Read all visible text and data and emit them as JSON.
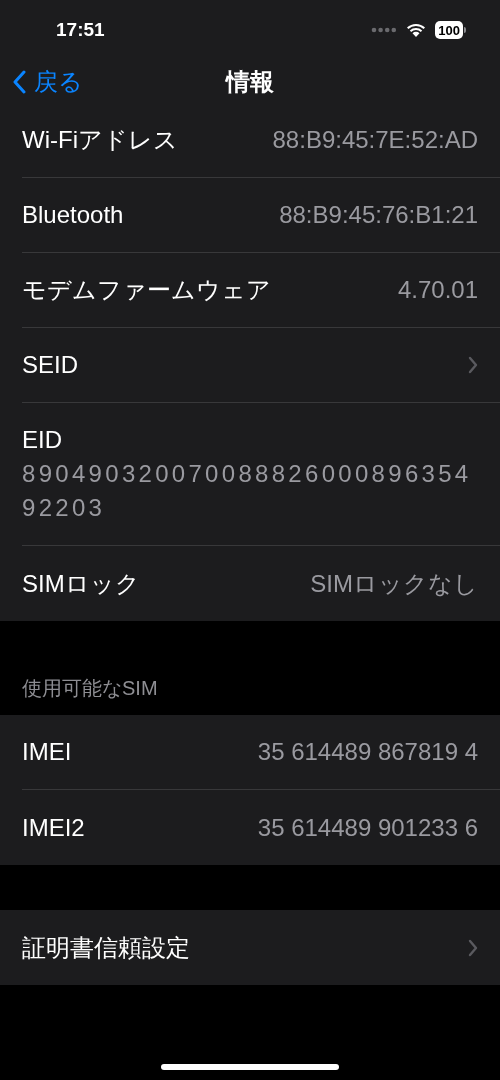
{
  "status_bar": {
    "time": "17:51",
    "battery": "100"
  },
  "nav": {
    "back": "戻る",
    "title": "情報"
  },
  "groups": [
    {
      "rows": [
        {
          "kind": "value",
          "label": "Wi-Fiアドレス",
          "value": "88:B9:45:7E:52:AD"
        },
        {
          "kind": "value",
          "label": "Bluetooth",
          "value": "88:B9:45:76:B1:21"
        },
        {
          "kind": "value",
          "label": "モデムファームウェア",
          "value": "4.70.01"
        },
        {
          "kind": "chevron",
          "label": "SEID"
        },
        {
          "kind": "stacked",
          "label": "EID",
          "value": "89049032007008882600089635492203"
        },
        {
          "kind": "value",
          "label": "SIMロック",
          "value": "SIMロックなし"
        }
      ]
    },
    {
      "header": "使用可能なSIM",
      "rows": [
        {
          "kind": "value",
          "label": "IMEI",
          "value": "35 614489 867819 4"
        },
        {
          "kind": "value",
          "label": "IMEI2",
          "value": "35 614489 901233 6"
        }
      ]
    },
    {
      "rows": [
        {
          "kind": "chevron",
          "label": "証明書信頼設定"
        }
      ]
    }
  ]
}
